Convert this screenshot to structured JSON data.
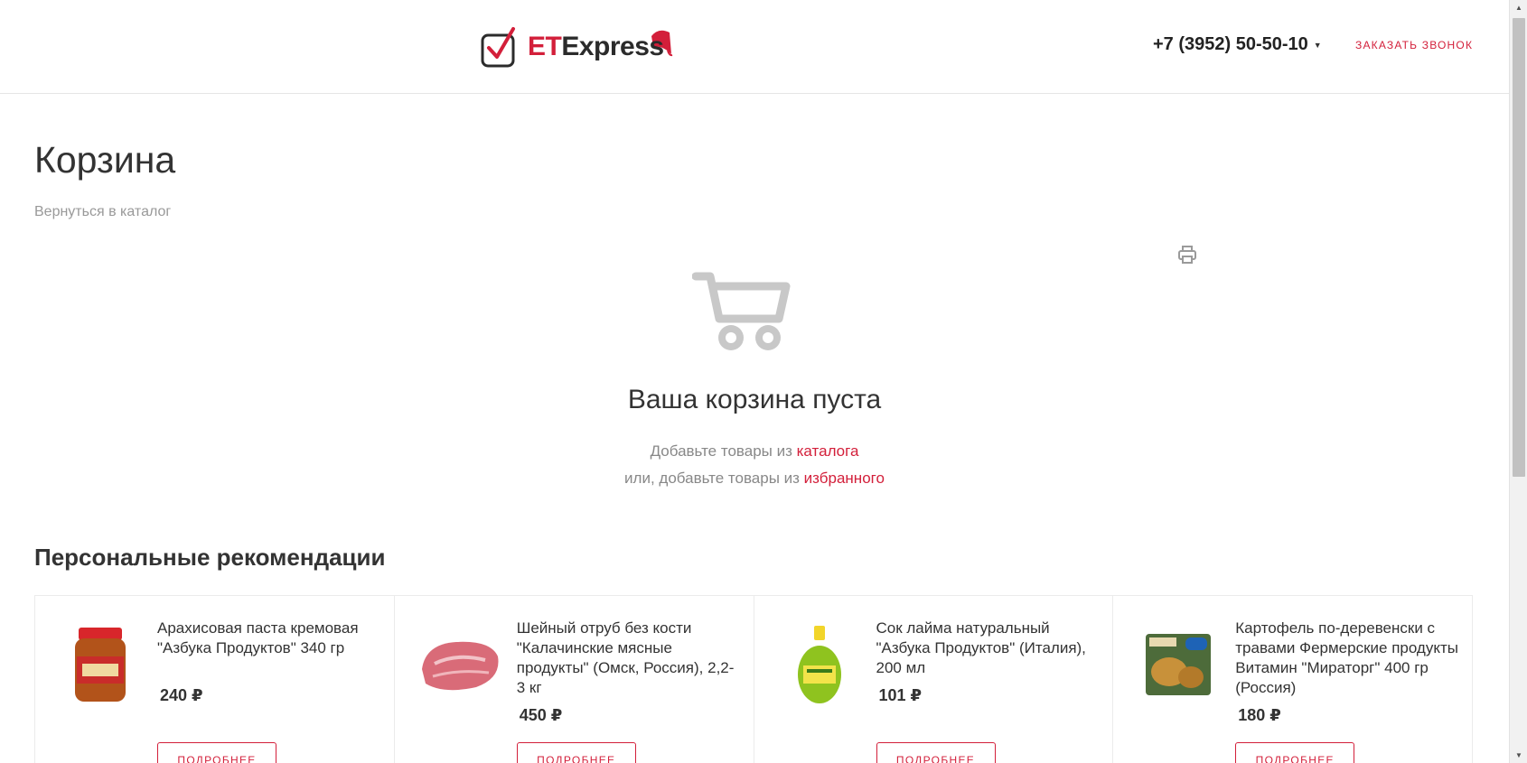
{
  "header": {
    "logo_prefix": "ET",
    "logo_suffix": "Express",
    "phone": "+7 (3952) 50-50-10",
    "callback_label": "Заказать звонок"
  },
  "main": {
    "title": "Корзина",
    "back_link": "Вернуться в каталог",
    "empty_title": "Ваша корзина пуста",
    "line1_text": "Добавьте товары из ",
    "line1_link": "каталога",
    "line2_text": "или, добавьте товары из ",
    "line2_link": "избранного"
  },
  "recommendations": {
    "title": "Персональные рекомендации",
    "button_label": "Подробнее",
    "items": [
      {
        "name": "Арахисовая паста кремовая \"Азбука Продуктов\" 340 гр",
        "price": "240 ₽",
        "image": "peanut-butter-jar"
      },
      {
        "name": "Шейный отруб без кости \"Калачинские мясные продукты\" (Омск, Россия), 2,2-3 кг",
        "price": "450 ₽",
        "image": "pork-neck-cut"
      },
      {
        "name": "Сок лайма натуральный \"Азбука Продуктов\" (Италия), 200 мл",
        "price": "101 ₽",
        "image": "lime-juice-bottle"
      },
      {
        "name": "Картофель по-деревенски с травами Фермерские продукты Витамин \"Мираторг\" 400 гр (Россия)",
        "price": "180 ₽",
        "image": "potato-wedges-bag"
      }
    ]
  },
  "colors": {
    "accent": "#d31f3a",
    "text": "#333333",
    "muted": "#999999",
    "icon_gray": "#c8c8c8"
  }
}
